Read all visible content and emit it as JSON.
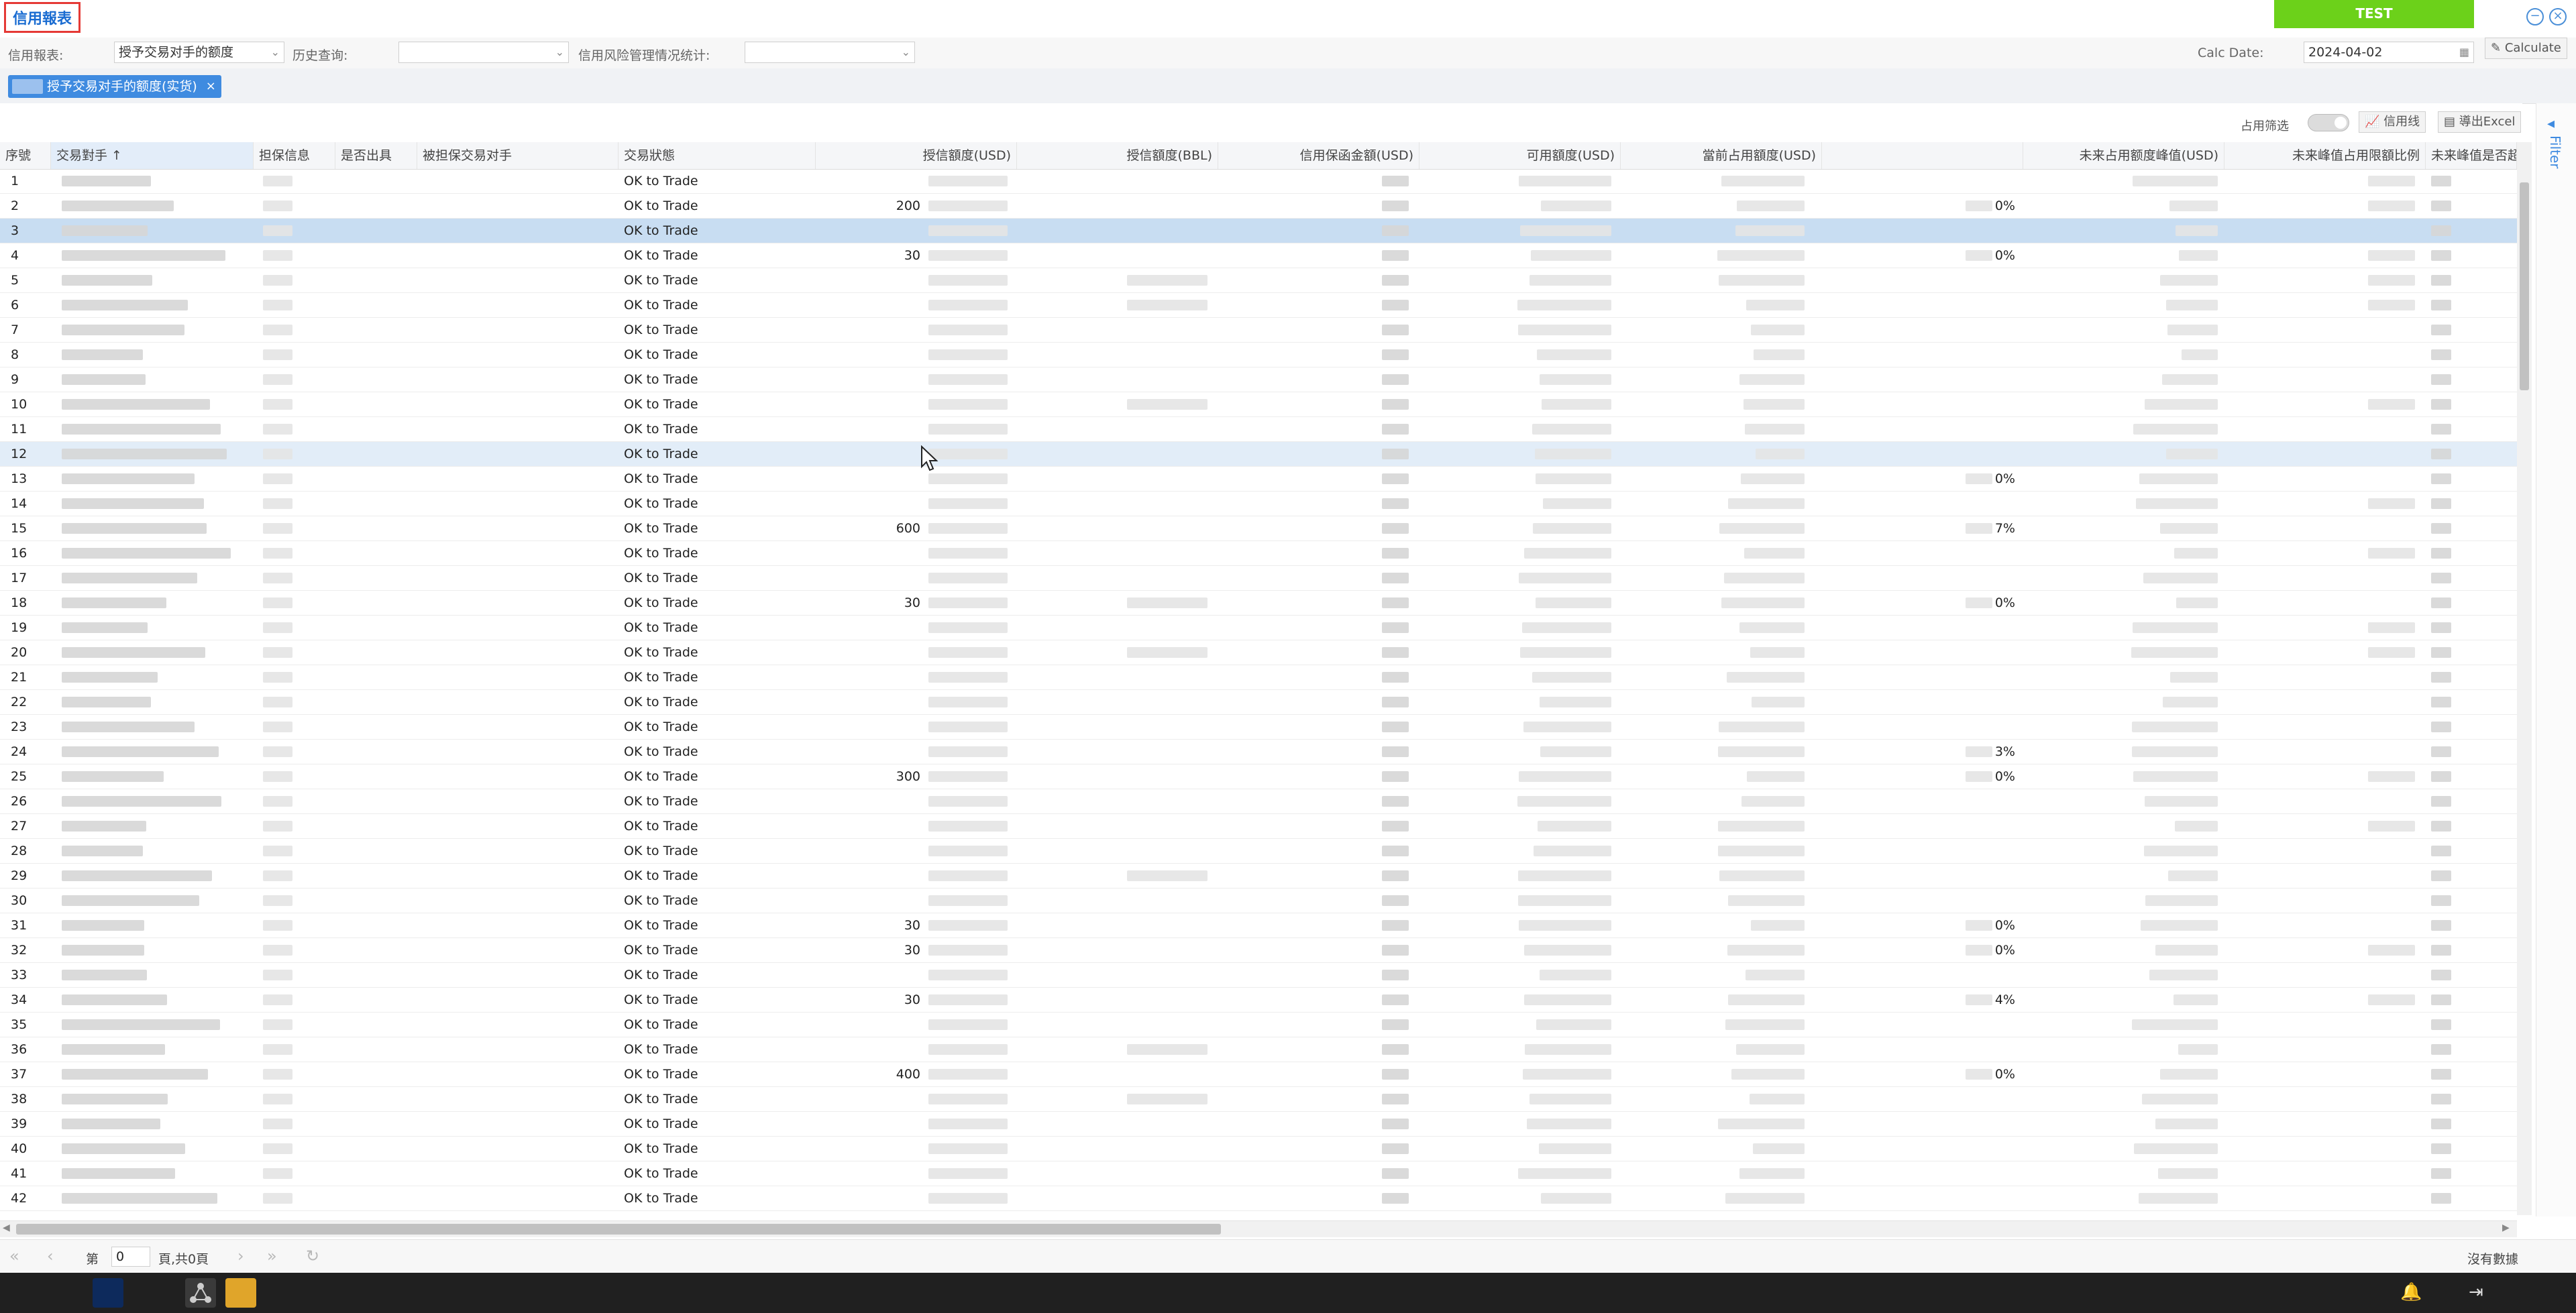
{
  "app": {
    "title": "信用報表",
    "test_button": "TEST",
    "minimize": "−",
    "close": "×"
  },
  "filters": {
    "report_label": "信用報表:",
    "report_value": "授予交易对手的额度",
    "history_label": "历史查询:",
    "history_value": "",
    "risk_label": "信用风险管理情况统计:",
    "risk_value": "",
    "calc_date_label": "Calc Date:",
    "calc_date_value": "2024-04-02",
    "calculate_button": "Calculate"
  },
  "tabs": {
    "active_label": "授予交易对手的额度(实货)",
    "close": "×"
  },
  "toolbar": {
    "occupy_filter_label": "占用筛选",
    "credit_line_button": "信用线",
    "export_button": "導出Excel"
  },
  "filter_panel": {
    "label": "Filter"
  },
  "table": {
    "headers": [
      "序號",
      "交易對手 ↑",
      "担保信息",
      "是否出具",
      "被担保交易对手",
      "交易狀態",
      "授信額度(USD)",
      "授信額度(BBL)",
      "信用保函金額(USD)",
      "可用額度(USD)",
      "當前占用額度(USD)",
      "",
      "未来占用额度峰值(USD)",
      "未来峰值占用限額比例",
      "未来峰值是否超限"
    ],
    "status_text": "OK to Trade",
    "rows": [
      {
        "no": "1",
        "credit": "",
        "pct": ""
      },
      {
        "no": "2",
        "credit": "200",
        "pct": "0%"
      },
      {
        "no": "3",
        "credit": "",
        "pct": ""
      },
      {
        "no": "4",
        "credit": "30",
        "pct": "0%"
      },
      {
        "no": "5",
        "credit": "",
        "pct": ""
      },
      {
        "no": "6",
        "credit": "",
        "pct": ""
      },
      {
        "no": "7",
        "credit": "",
        "pct": ""
      },
      {
        "no": "8",
        "credit": "",
        "pct": ""
      },
      {
        "no": "9",
        "credit": "",
        "pct": ""
      },
      {
        "no": "10",
        "credit": "",
        "pct": ""
      },
      {
        "no": "11",
        "credit": "",
        "pct": ""
      },
      {
        "no": "12",
        "credit": "",
        "pct": ""
      },
      {
        "no": "13",
        "credit": "",
        "pct": "0%"
      },
      {
        "no": "14",
        "credit": "",
        "pct": ""
      },
      {
        "no": "15",
        "credit": "600",
        "pct": "7%"
      },
      {
        "no": "16",
        "credit": "",
        "pct": ""
      },
      {
        "no": "17",
        "credit": "",
        "pct": ""
      },
      {
        "no": "18",
        "credit": "30",
        "pct": "0%"
      },
      {
        "no": "19",
        "credit": "",
        "pct": ""
      },
      {
        "no": "20",
        "credit": "",
        "pct": ""
      },
      {
        "no": "21",
        "credit": "",
        "pct": ""
      },
      {
        "no": "22",
        "credit": "",
        "pct": ""
      },
      {
        "no": "23",
        "credit": "",
        "pct": ""
      },
      {
        "no": "24",
        "credit": "",
        "pct": "3%"
      },
      {
        "no": "25",
        "credit": "300",
        "pct": "0%"
      },
      {
        "no": "26",
        "credit": "",
        "pct": ""
      },
      {
        "no": "27",
        "credit": "",
        "pct": ""
      },
      {
        "no": "28",
        "credit": "",
        "pct": ""
      },
      {
        "no": "29",
        "credit": "",
        "pct": ""
      },
      {
        "no": "30",
        "credit": "",
        "pct": ""
      },
      {
        "no": "31",
        "credit": "30",
        "pct": "0%"
      },
      {
        "no": "32",
        "credit": "30",
        "pct": "0%"
      },
      {
        "no": "33",
        "credit": "",
        "pct": ""
      },
      {
        "no": "34",
        "credit": "30",
        "pct": "4%"
      },
      {
        "no": "35",
        "credit": "",
        "pct": ""
      },
      {
        "no": "36",
        "credit": "",
        "pct": ""
      },
      {
        "no": "37",
        "credit": "400",
        "pct": "0%"
      },
      {
        "no": "38",
        "credit": "",
        "pct": ""
      },
      {
        "no": "39",
        "credit": "",
        "pct": ""
      },
      {
        "no": "40",
        "credit": "",
        "pct": ""
      },
      {
        "no": "41",
        "credit": "",
        "pct": ""
      },
      {
        "no": "42",
        "credit": "",
        "pct": ""
      }
    ],
    "selected_row": "3",
    "hover_row": "12"
  },
  "pager": {
    "page_prefix": "第",
    "page_value": "0",
    "page_suffix": "頁,共0頁",
    "no_data": "沒有數據"
  },
  "taskbar": {
    "icons": [
      "ibm-app-icon",
      "network-app-icon",
      "spreadsheet-app-icon",
      "notification-icon",
      "logout-icon"
    ]
  },
  "colors": {
    "accent": "#3f8be0",
    "test_green": "#6cd11a",
    "selected_row": "#c8ddf2",
    "title_border": "#e53935"
  }
}
